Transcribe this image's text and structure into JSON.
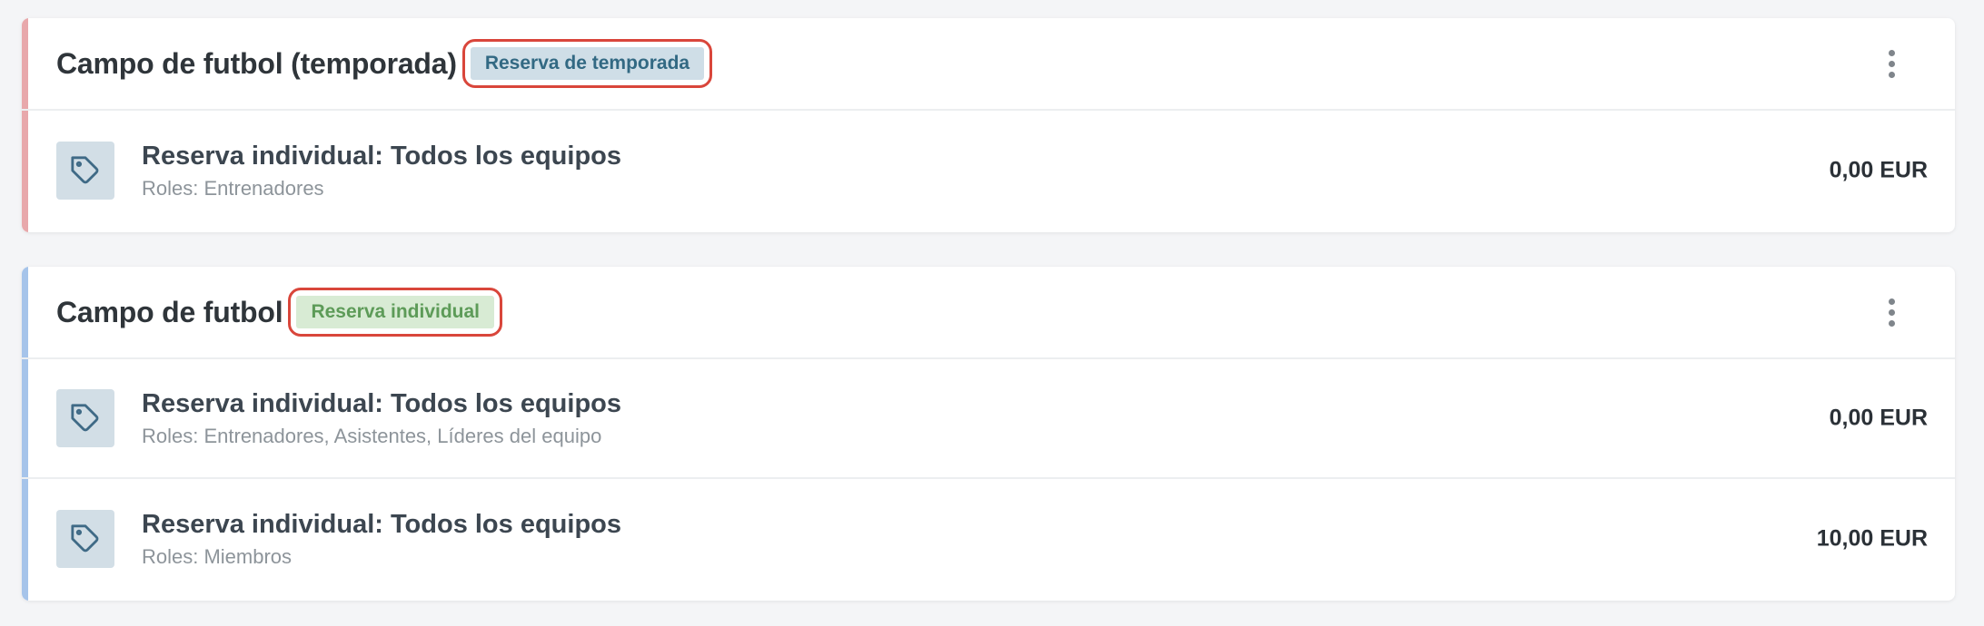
{
  "cards": [
    {
      "title": "Campo de futbol (temporada)",
      "badge": "Reserva de temporada",
      "accent_color": "#e8a8ab",
      "badge_bg": "#cfdee7",
      "badge_color": "#326983",
      "rows": [
        {
          "icon": "tag-icon",
          "title": "Reserva individual: Todos los equipos",
          "roles": "Roles: Entrenadores",
          "price": "0,00 EUR"
        }
      ]
    },
    {
      "title": "Campo de futbol",
      "badge": "Reserva individual",
      "accent_color": "#a6c4ea",
      "badge_bg": "#d8ebd4",
      "badge_color": "#5d9b58",
      "rows": [
        {
          "icon": "tag-icon",
          "title": "Reserva individual: Todos los equipos",
          "roles": "Roles: Entrenadores, Asistentes, Líderes del equipo",
          "price": "0,00 EUR"
        },
        {
          "icon": "tag-icon",
          "title": "Reserva individual: Todos los equipos",
          "roles": "Roles: Miembros",
          "price": "10,00 EUR"
        }
      ]
    }
  ],
  "highlight_color": "#d9463b"
}
